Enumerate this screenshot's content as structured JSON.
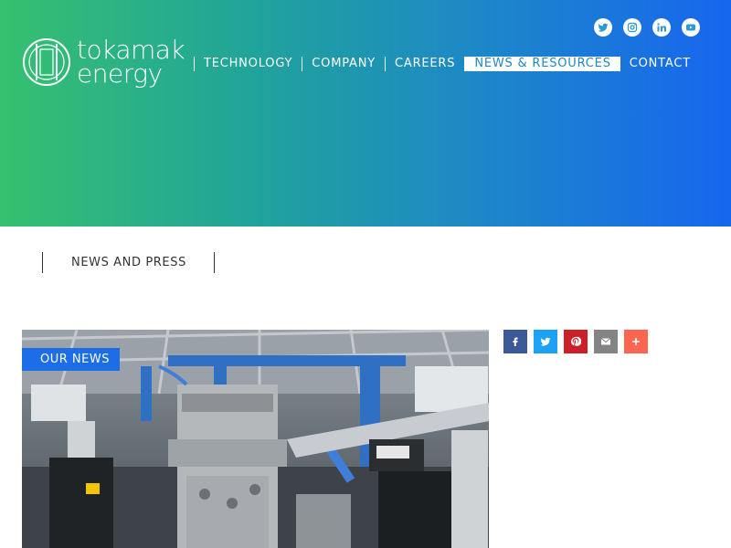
{
  "brand": {
    "name_line1": "tokamak",
    "name_line2": "energy"
  },
  "social": [
    {
      "name": "twitter-icon"
    },
    {
      "name": "instagram-icon"
    },
    {
      "name": "linkedin-icon"
    },
    {
      "name": "youtube-icon"
    }
  ],
  "nav": {
    "items": [
      {
        "label": "TECHNOLOGY"
      },
      {
        "label": "COMPANY"
      },
      {
        "label": "CAREERS"
      },
      {
        "label": "NEWS & RESOURCES"
      },
      {
        "label": "CONTACT"
      }
    ],
    "active": "NEWS & RESOURCES"
  },
  "breadcrumb": {
    "label": "NEWS AND PRESS"
  },
  "article": {
    "badge": "OUR NEWS"
  },
  "share": [
    {
      "name": "facebook-share-icon",
      "color": "#3b5998"
    },
    {
      "name": "twitter-share-icon",
      "color": "#1da1f2"
    },
    {
      "name": "pinterest-share-icon",
      "color": "#cb2027"
    },
    {
      "name": "email-share-icon",
      "color": "#848484"
    },
    {
      "name": "more-share-icon",
      "color": "#ff6550"
    }
  ],
  "colors": {
    "accent": "#1d6ee6",
    "hero_start": "#36c06f",
    "hero_end": "#1766ee"
  }
}
